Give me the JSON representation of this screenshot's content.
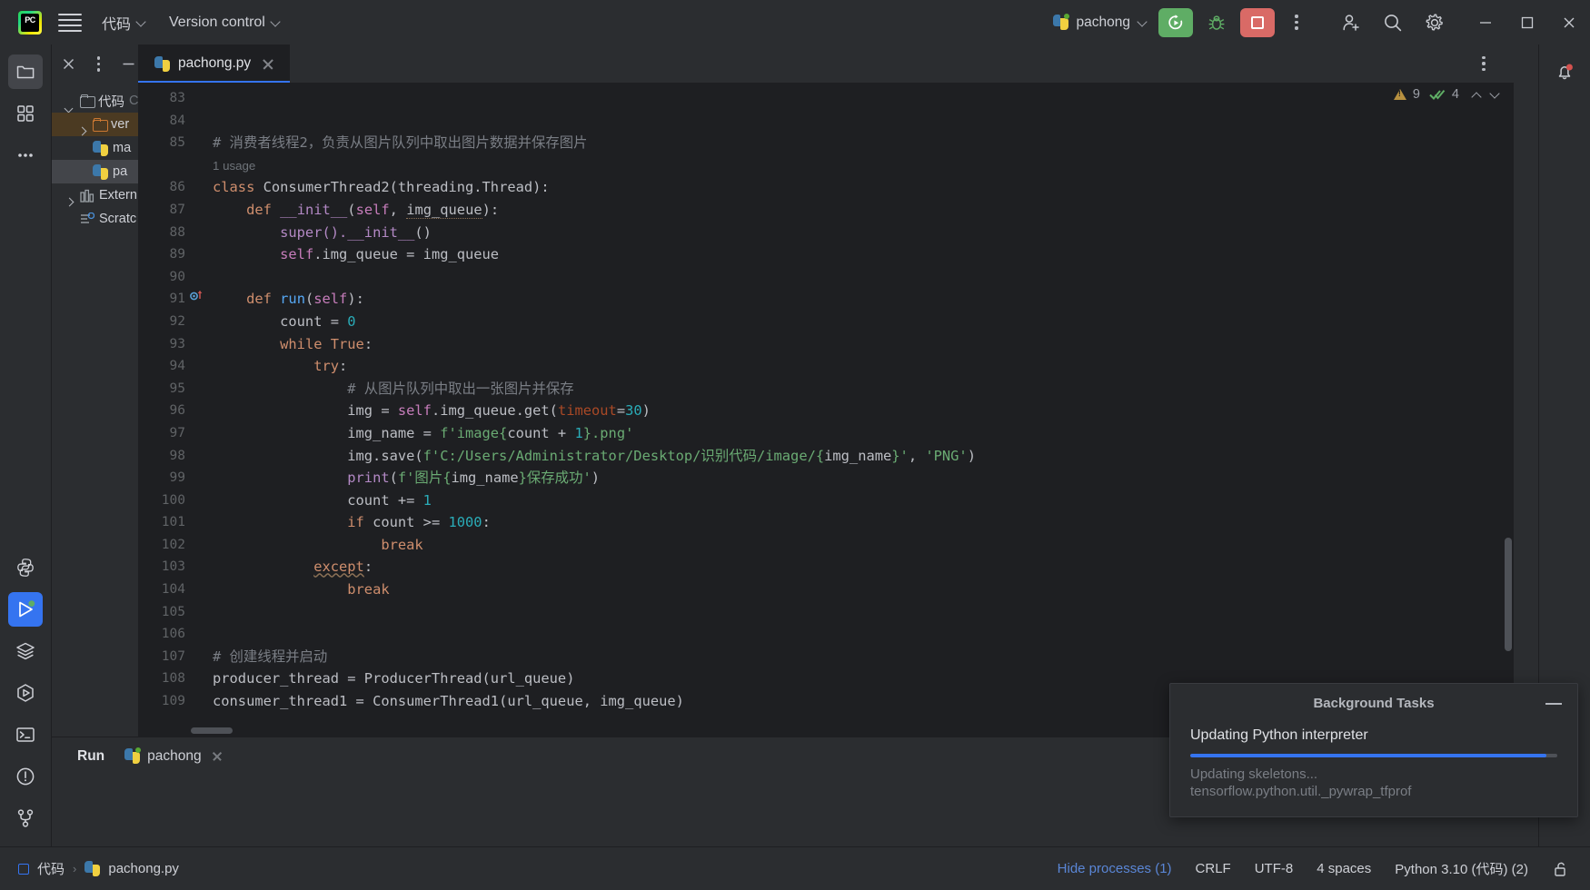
{
  "window": {
    "app_name": "PyCharm",
    "logo_text": "PC"
  },
  "titlebar": {
    "menu_burger": "main-menu",
    "project_name": "代码",
    "vcs_label": "Version control",
    "run_config": "pachong",
    "buttons": {
      "run": "Run",
      "debug": "Debug",
      "stop": "Stop",
      "more": "More",
      "account": "Account settings",
      "search": "Search everywhere",
      "settings": "Settings"
    },
    "window_controls": {
      "minimize": "Minimize",
      "maximize": "Maximize",
      "close": "Close"
    }
  },
  "activitybar": {
    "items": [
      {
        "icon": "project-folder-icon",
        "label": "Project",
        "selected": true
      },
      {
        "icon": "structure-icon",
        "label": "Structure",
        "selected": false
      },
      {
        "icon": "more-tool-windows-icon",
        "label": "More tool windows",
        "selected": false
      }
    ],
    "bottom_items": [
      {
        "icon": "python-console-icon",
        "label": "Python Console",
        "selected": false
      },
      {
        "icon": "run-icon",
        "label": "Run",
        "selected": true
      },
      {
        "icon": "services-icon",
        "label": "Services",
        "selected": false
      },
      {
        "icon": "python-packages-icon",
        "label": "Python Packages",
        "selected": false
      },
      {
        "icon": "terminal-icon",
        "label": "Terminal",
        "selected": false
      },
      {
        "icon": "problems-icon",
        "label": "Problems",
        "selected": false
      },
      {
        "icon": "version-control-icon",
        "label": "Version Control",
        "selected": false
      }
    ]
  },
  "project_panel": {
    "header_buttons": [
      "close-icon",
      "options-kebab-icon",
      "hide-icon"
    ],
    "tree": [
      {
        "label": "代码",
        "suffix": "C",
        "icon": "folder-icon",
        "arrow": "down",
        "depth": 0,
        "state": "normal"
      },
      {
        "label": "ver",
        "icon": "folder-icon-orange",
        "arrow": "right",
        "depth": 1,
        "state": "highlighted"
      },
      {
        "label": "ma",
        "icon": "python-file-icon",
        "arrow": "none",
        "depth": 2,
        "state": "normal"
      },
      {
        "label": "pa",
        "icon": "python-file-icon",
        "arrow": "none",
        "depth": 2,
        "state": "selected"
      },
      {
        "label": "Extern",
        "icon": "library-icon",
        "arrow": "right",
        "depth": 0,
        "state": "normal"
      },
      {
        "label": "Scratc",
        "icon": "scratches-icon",
        "arrow": "none",
        "depth": 0,
        "state": "normal"
      }
    ]
  },
  "editor": {
    "tab": {
      "filename": "pachong.py",
      "icon": "python-file-icon",
      "close": "close-tab"
    },
    "tab_options_icon": "kebab-icon",
    "inspections": {
      "warning_count": "9",
      "check_count": "4",
      "prev_label": "Previous highlighted error",
      "next_label": "Next highlighted error"
    },
    "first_line_number": 83,
    "lines": [
      {
        "n": 83,
        "tokens": []
      },
      {
        "n": 84,
        "tokens": []
      },
      {
        "n": 85,
        "tokens": [
          {
            "t": "# 消费者线程2，负责从图片队列中取出图片数据并保存图片",
            "c": "cmt"
          }
        ]
      },
      {
        "n": null,
        "usage": "1 usage"
      },
      {
        "n": 86,
        "tokens": [
          {
            "t": "class ",
            "c": "kw"
          },
          {
            "t": "ConsumerThread2",
            "c": "cls"
          },
          {
            "t": "(threading.Thread):",
            "c": "plain"
          }
        ]
      },
      {
        "n": 87,
        "tokens": [
          {
            "t": "    ",
            "c": "plain"
          },
          {
            "t": "def ",
            "c": "kw"
          },
          {
            "t": "__init__",
            "c": "dund"
          },
          {
            "t": "(",
            "c": "plain"
          },
          {
            "t": "self",
            "c": "selfk"
          },
          {
            "t": ", ",
            "c": "plain"
          },
          {
            "t": "img_queue",
            "c": "warn-u"
          },
          {
            "t": "):",
            "c": "plain"
          }
        ]
      },
      {
        "n": 88,
        "tokens": [
          {
            "t": "        super().",
            "c": "mag"
          },
          {
            "t": "__init__",
            "c": "dund"
          },
          {
            "t": "()",
            "c": "plain"
          }
        ]
      },
      {
        "n": 89,
        "tokens": [
          {
            "t": "        ",
            "c": "plain"
          },
          {
            "t": "self",
            "c": "selfk"
          },
          {
            "t": ".img_queue = img_queue",
            "c": "plain"
          }
        ]
      },
      {
        "n": 90,
        "tokens": []
      },
      {
        "n": 91,
        "marker": "run-gutter-icon",
        "tokens": [
          {
            "t": "    ",
            "c": "plain"
          },
          {
            "t": "def ",
            "c": "kw"
          },
          {
            "t": "run",
            "c": "fn"
          },
          {
            "t": "(",
            "c": "plain"
          },
          {
            "t": "self",
            "c": "selfk"
          },
          {
            "t": "):",
            "c": "plain"
          }
        ]
      },
      {
        "n": 92,
        "tokens": [
          {
            "t": "        count = ",
            "c": "plain"
          },
          {
            "t": "0",
            "c": "num"
          }
        ]
      },
      {
        "n": 93,
        "tokens": [
          {
            "t": "        ",
            "c": "plain"
          },
          {
            "t": "while True",
            "c": "kw"
          },
          {
            "t": ":",
            "c": "plain"
          }
        ]
      },
      {
        "n": 94,
        "tokens": [
          {
            "t": "            ",
            "c": "plain"
          },
          {
            "t": "try",
            "c": "kw"
          },
          {
            "t": ":",
            "c": "plain"
          }
        ]
      },
      {
        "n": 95,
        "tokens": [
          {
            "t": "                # 从图片队列中取出一张图片并保存",
            "c": "cmt"
          }
        ]
      },
      {
        "n": 96,
        "tokens": [
          {
            "t": "                img = ",
            "c": "plain"
          },
          {
            "t": "self",
            "c": "selfk"
          },
          {
            "t": ".img_queue.get(",
            "c": "plain"
          },
          {
            "t": "timeout",
            "c": "kwarg"
          },
          {
            "t": "=",
            "c": "plain"
          },
          {
            "t": "30",
            "c": "num"
          },
          {
            "t": ")",
            "c": "plain"
          }
        ]
      },
      {
        "n": 97,
        "tokens": [
          {
            "t": "                img_name = ",
            "c": "plain"
          },
          {
            "t": "f'image{",
            "c": "str"
          },
          {
            "t": "count + ",
            "c": "plain"
          },
          {
            "t": "1",
            "c": "num"
          },
          {
            "t": "}.png'",
            "c": "str"
          }
        ]
      },
      {
        "n": 98,
        "tokens": [
          {
            "t": "                img.save(",
            "c": "plain"
          },
          {
            "t": "f'C:/Users/Administrator/Desktop/识别代码/image/{",
            "c": "str"
          },
          {
            "t": "img_name",
            "c": "plain"
          },
          {
            "t": "}'",
            "c": "str"
          },
          {
            "t": ", ",
            "c": "plain"
          },
          {
            "t": "'PNG'",
            "c": "str"
          },
          {
            "t": ")",
            "c": "plain"
          }
        ]
      },
      {
        "n": 99,
        "tokens": [
          {
            "t": "                ",
            "c": "plain"
          },
          {
            "t": "print",
            "c": "mag"
          },
          {
            "t": "(",
            "c": "plain"
          },
          {
            "t": "f'图片{",
            "c": "str"
          },
          {
            "t": "img_name",
            "c": "plain"
          },
          {
            "t": "}保存成功'",
            "c": "str"
          },
          {
            "t": ")",
            "c": "plain"
          }
        ]
      },
      {
        "n": 100,
        "tokens": [
          {
            "t": "                count += ",
            "c": "plain"
          },
          {
            "t": "1",
            "c": "num"
          }
        ]
      },
      {
        "n": 101,
        "tokens": [
          {
            "t": "                ",
            "c": "plain"
          },
          {
            "t": "if ",
            "c": "kw"
          },
          {
            "t": "count >= ",
            "c": "plain"
          },
          {
            "t": "1000",
            "c": "num"
          },
          {
            "t": ":",
            "c": "plain"
          }
        ]
      },
      {
        "n": 102,
        "tokens": [
          {
            "t": "                    ",
            "c": "plain"
          },
          {
            "t": "break",
            "c": "kw"
          }
        ]
      },
      {
        "n": 103,
        "tokens": [
          {
            "t": "            ",
            "c": "plain"
          },
          {
            "t": "except",
            "c": "kw err-u"
          },
          {
            "t": ":",
            "c": "plain"
          }
        ]
      },
      {
        "n": 104,
        "tokens": [
          {
            "t": "                ",
            "c": "plain"
          },
          {
            "t": "break",
            "c": "kw"
          }
        ]
      },
      {
        "n": 105,
        "tokens": []
      },
      {
        "n": 106,
        "tokens": []
      },
      {
        "n": 107,
        "tokens": [
          {
            "t": "# 创建线程并启动",
            "c": "cmt"
          }
        ]
      },
      {
        "n": 108,
        "tokens": [
          {
            "t": "producer_thread = ",
            "c": "plain"
          },
          {
            "t": "ProducerThread",
            "c": "cls"
          },
          {
            "t": "(url_queue)",
            "c": "plain"
          }
        ]
      },
      {
        "n": 109,
        "tokens": [
          {
            "t": "consumer_thread1 = ",
            "c": "plain"
          },
          {
            "t": "ConsumerThread1",
            "c": "cls"
          },
          {
            "t": "(url_queue, img_queue)",
            "c": "plain"
          }
        ]
      }
    ]
  },
  "background_tasks": {
    "title": "Background Tasks",
    "minimize_label": "Minimize",
    "task_name": "Updating Python interpreter",
    "progress_percent": 97,
    "detail_line1": "Updating skeletons...",
    "detail_line2": "tensorflow.python.util._pywrap_tfprof",
    "accent_color": "#3574f0"
  },
  "run_panel": {
    "title": "Run",
    "tab_label": "pachong",
    "tab_icon": "python-file-icon",
    "close_label": "Close tab"
  },
  "statusbar": {
    "breadcrumb": [
      {
        "label": "代码",
        "icon": "module-icon"
      },
      {
        "label": "pachong.py",
        "icon": "python-file-icon"
      }
    ],
    "right_items": [
      {
        "label": "Hide processes (1)",
        "style": "link",
        "name": "hide-processes"
      },
      {
        "label": "CRLF",
        "style": "normal",
        "name": "line-separator"
      },
      {
        "label": "UTF-8",
        "style": "normal",
        "name": "file-encoding"
      },
      {
        "label": "4 spaces",
        "style": "normal",
        "name": "indent-setting"
      },
      {
        "label": "Python 3.10 (代码) (2)",
        "style": "normal",
        "name": "interpreter"
      }
    ],
    "lock_icon": "unlock-icon"
  },
  "notifications": {
    "icon": "bell-icon",
    "has_badge": true,
    "badge_color": "#d4524f"
  },
  "colors": {
    "editor_bg": "#1e1f22",
    "panel_bg": "#2b2d30",
    "accent": "#3574f0",
    "run_green": "#5fad65",
    "stop_red": "#d96a66",
    "selection": "#43454a"
  }
}
